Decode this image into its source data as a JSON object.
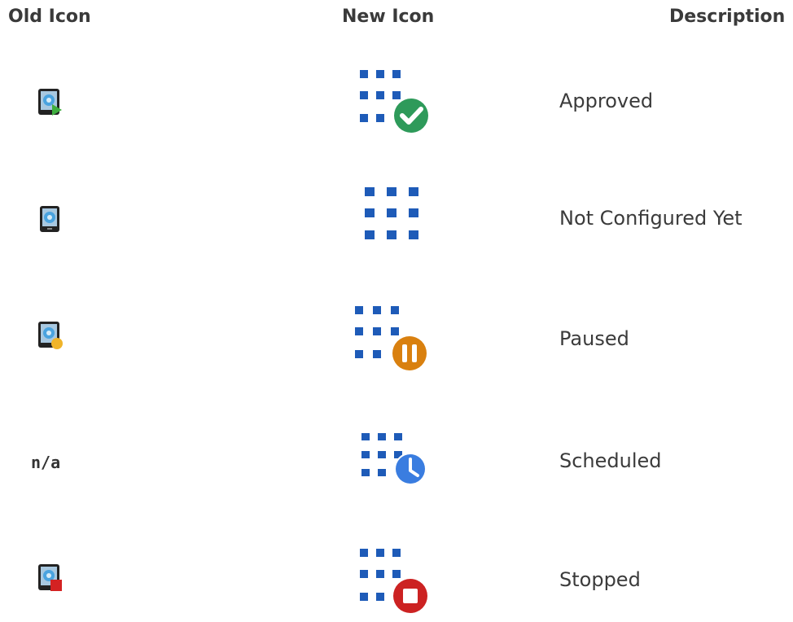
{
  "headers": {
    "old_icon": "Old Icon",
    "new_icon": "New Icon",
    "description": "Description"
  },
  "rows": [
    {
      "old_icon": "tablet-play-icon",
      "old_text": "",
      "new_icon": "grid-check-icon",
      "badge_color": "#2e9a5a",
      "description": "Approved"
    },
    {
      "old_icon": "tablet-icon",
      "old_text": "",
      "new_icon": "grid-icon",
      "badge_color": "",
      "description": "Not Configured Yet"
    },
    {
      "old_icon": "tablet-pause-icon",
      "old_text": "",
      "new_icon": "grid-pause-icon",
      "badge_color": "#d9800f",
      "description": "Paused"
    },
    {
      "old_icon": "",
      "old_text": "n/a",
      "new_icon": "grid-clock-icon",
      "badge_color": "#3a7de0",
      "description": "Scheduled"
    },
    {
      "old_icon": "tablet-stop-icon",
      "old_text": "",
      "new_icon": "grid-stop-icon",
      "badge_color": "#cc2222",
      "description": "Stopped"
    }
  ],
  "colors": {
    "grid_blue": "#1e5bb8"
  }
}
